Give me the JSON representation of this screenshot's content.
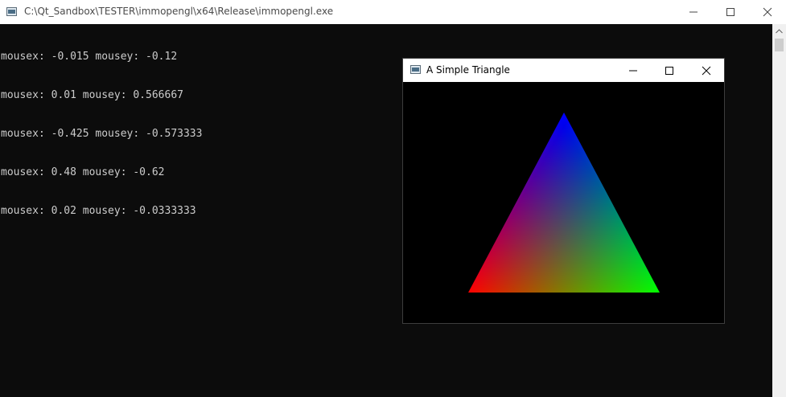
{
  "console": {
    "title": "C:\\Qt_Sandbox\\TESTER\\immopengl\\x64\\Release\\immopengl.exe",
    "lines": [
      "mousex: -0.015 mousey: -0.12",
      "mousex: 0.01 mousey: 0.566667",
      "mousex: -0.425 mousey: -0.573333",
      "mousex: 0.48 mousey: -0.62",
      "mousex: 0.02 mousey: -0.0333333"
    ],
    "background": "#0c0c0c",
    "text_color": "#cccccc"
  },
  "triangle_window": {
    "title": "A Simple Triangle",
    "vertex_colors": {
      "top": "#0000ff",
      "bottom_left": "#ff0000",
      "bottom_right": "#00ff00"
    }
  },
  "icons": {
    "console_app": "console-app-icon",
    "triangle_app": "window-app-icon",
    "minimize": "minimize-icon",
    "maximize": "maximize-icon",
    "close": "close-icon"
  }
}
